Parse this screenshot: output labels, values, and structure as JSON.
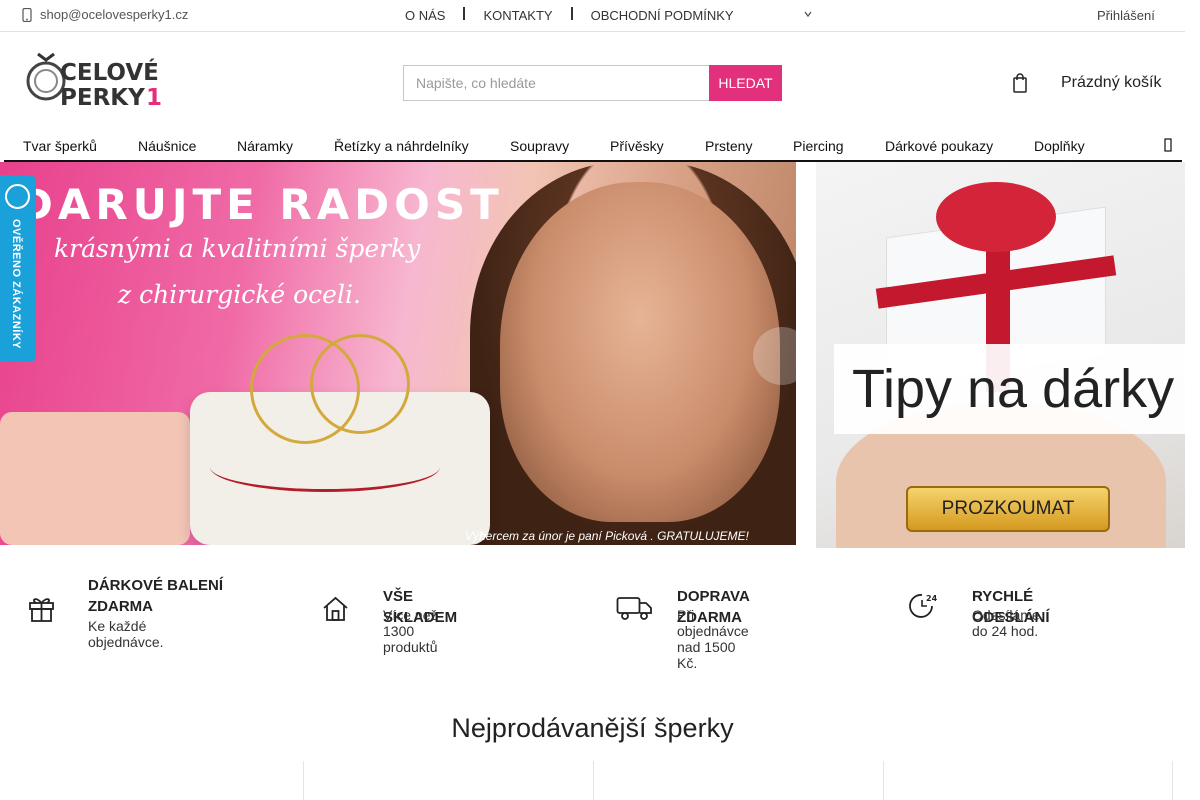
{
  "topbar": {
    "email": "shop@ocelovesperky1.cz",
    "links": [
      "O NÁS",
      "KONTAKTY",
      "OBCHODNÍ PODMÍNKY"
    ],
    "login": "Přihlášení"
  },
  "header": {
    "logo_alt": "ŠPERKY1",
    "search_placeholder": "Napište, co hledáte",
    "search_button": "HLEDAT",
    "cart_label": "Prázdný košík"
  },
  "nav": {
    "items": [
      "Tvar šperků",
      "Náušnice",
      "Náramky",
      "Řetízky a náhrdelníky",
      "Soupravy",
      "Přívěsky",
      "Prsteny",
      "Piercing",
      "Dárkové poukazy",
      "Doplňky"
    ]
  },
  "hero": {
    "title": "DARUJTE RADOST",
    "line1": "krásnými a kvalitními šperky",
    "line2": "z chirurgické oceli.",
    "winner": "Výhercem za únor je paní Picková . GRATULUJEME!"
  },
  "side_banner": {
    "title": "Tipy na dárky",
    "button": "PROZKOUMAT"
  },
  "badge": {
    "label": "OVĚŘENO ZÁKAZNÍKY"
  },
  "benefits": [
    {
      "title": "DÁRKOVÉ BALENÍ ZDARMA",
      "desc": "Ke každé objednávce."
    },
    {
      "title": "VŠE SKLADEM",
      "desc": "Více než 1300 produktů"
    },
    {
      "title": "DOPRAVA ZDARMA",
      "desc": "Při objednávce nad 1500 Kč."
    },
    {
      "title": "RYCHLÉ ODESLÁNÍ",
      "desc": "Odesíláme do 24 hod."
    }
  ],
  "bestsellers": {
    "title": "Nejprodávanější šperky"
  },
  "colors": {
    "accent": "#e3307c",
    "badge": "#1aa1d9"
  }
}
